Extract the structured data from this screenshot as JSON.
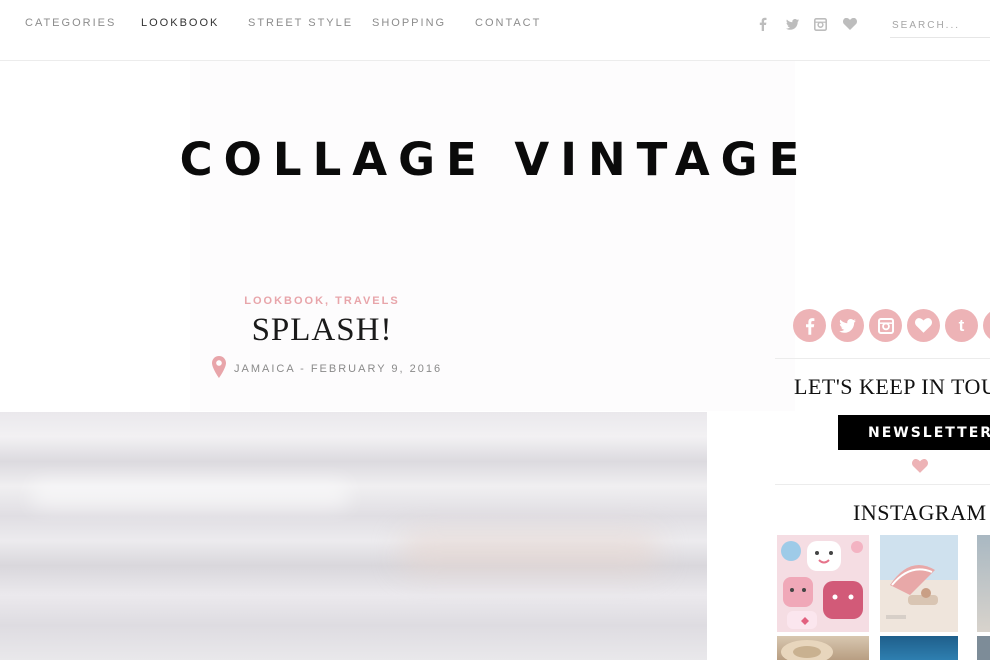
{
  "nav": {
    "items": [
      {
        "label": "CATEGORIES",
        "active": false
      },
      {
        "label": "LOOKBOOK",
        "active": true
      },
      {
        "label": "STREET STYLE",
        "active": false
      },
      {
        "label": "SHOPPING",
        "active": false
      },
      {
        "label": "CONTACT",
        "active": false
      }
    ],
    "social_icons": [
      "facebook-icon",
      "twitter-icon",
      "instagram-icon",
      "heart-icon"
    ],
    "search_placeholder": "SEARCH..."
  },
  "site": {
    "logo": "COLLAGE VINTAGE"
  },
  "post": {
    "categories": "LOOKBOOK, TRAVELS",
    "title": "SPLASH!",
    "meta": "JAMAICA - FEBRUARY 9, 2016",
    "location_icon": "map-pin-icon"
  },
  "sidebar": {
    "social_icons": [
      {
        "name": "facebook-icon",
        "glyph": "f"
      },
      {
        "name": "twitter-icon",
        "glyph": "t"
      },
      {
        "name": "instagram-icon",
        "glyph": ""
      },
      {
        "name": "bloglovin-heart-icon",
        "glyph": ""
      },
      {
        "name": "tumblr-icon",
        "glyph": "t"
      },
      {
        "name": "pinterest-icon",
        "glyph": ""
      }
    ],
    "keep_in_touch": "LET'S KEEP IN TOUCH",
    "newsletter_label": "NEWSLETTER",
    "instagram_title": "INSTAGRAM"
  },
  "colors": {
    "accent_pink": "#edb3b6",
    "category_pink": "#e8a5aa",
    "nav_text": "#8c8c8c",
    "nav_active": "#333333",
    "button_black": "#000000"
  }
}
